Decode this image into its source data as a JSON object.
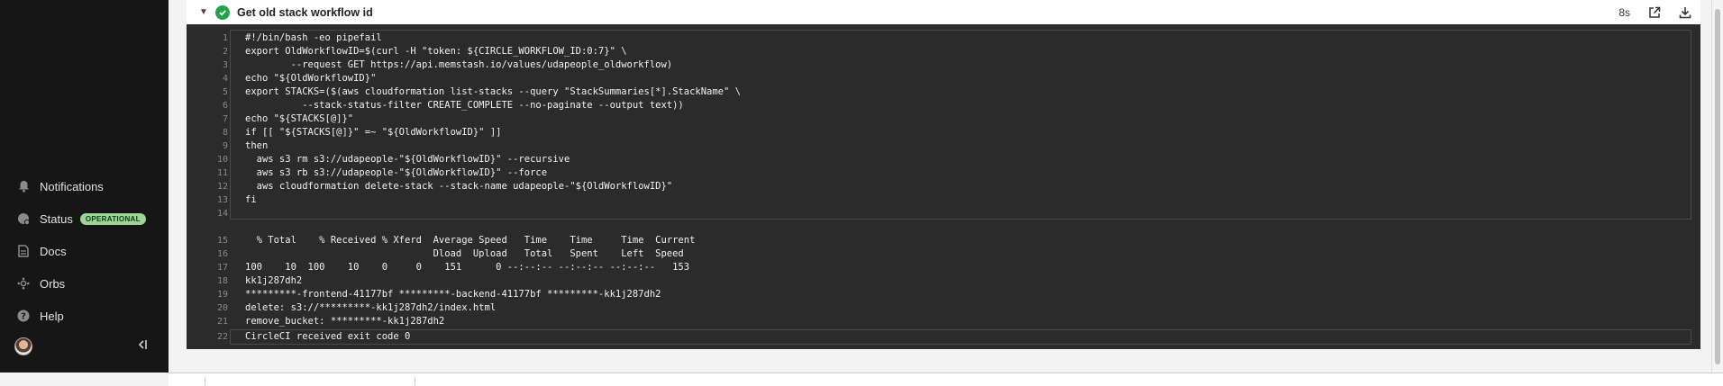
{
  "sidebar": {
    "items": [
      {
        "key": "notifications",
        "label": "Notifications",
        "icon": "bell-icon"
      },
      {
        "key": "status",
        "label": "Status",
        "icon": "status-icon",
        "badge": "OPERATIONAL"
      },
      {
        "key": "docs",
        "label": "Docs",
        "icon": "document-icon"
      },
      {
        "key": "orbs",
        "label": "Orbs",
        "icon": "orbs-icon"
      },
      {
        "key": "help",
        "label": "Help",
        "icon": "help-icon"
      }
    ]
  },
  "step": {
    "title": "Get old stack workflow id",
    "duration": "8s",
    "status": "success"
  },
  "script_lines": [
    {
      "n": "1",
      "text": "#!/bin/bash -eo pipefail"
    },
    {
      "n": "2",
      "text": "export OldWorkflowID=$(curl -H \"token: ${CIRCLE_WORKFLOW_ID:0:7}\" \\"
    },
    {
      "n": "3",
      "text": "        --request GET https://api.memstash.io/values/udapeople_oldworkflow)"
    },
    {
      "n": "4",
      "text": "echo \"${OldWorkflowID}\""
    },
    {
      "n": "5",
      "text": "export STACKS=($(aws cloudformation list-stacks --query \"StackSummaries[*].StackName\" \\"
    },
    {
      "n": "6",
      "text": "          --stack-status-filter CREATE_COMPLETE --no-paginate --output text))"
    },
    {
      "n": "7",
      "text": "echo \"${STACKS[@]}\""
    },
    {
      "n": "8",
      "text": "if [[ \"${STACKS[@]}\" =~ \"${OldWorkflowID}\" ]]"
    },
    {
      "n": "9",
      "text": "then"
    },
    {
      "n": "10",
      "text": "  aws s3 rm s3://udapeople-\"${OldWorkflowID}\" --recursive"
    },
    {
      "n": "11",
      "text": "  aws s3 rb s3://udapeople-\"${OldWorkflowID}\" --force"
    },
    {
      "n": "12",
      "text": "  aws cloudformation delete-stack --stack-name udapeople-\"${OldWorkflowID}\""
    },
    {
      "n": "13",
      "text": "fi"
    },
    {
      "n": "14",
      "text": ""
    }
  ],
  "output_lines": [
    {
      "n": "15",
      "text": "  % Total    % Received % Xferd  Average Speed   Time    Time     Time  Current"
    },
    {
      "n": "16",
      "text": "                                 Dload  Upload   Total   Spent    Left  Speed"
    },
    {
      "n": "17",
      "text": "100    10  100    10    0     0    151      0 --:--:-- --:--:-- --:--:--   153"
    },
    {
      "n": "18",
      "text": "kk1j287dh2"
    },
    {
      "n": "19",
      "text": "*********-frontend-41177bf *********-backend-41177bf *********-kk1j287dh2"
    },
    {
      "n": "20",
      "text": "delete: s3://*********-kk1j287dh2/index.html"
    },
    {
      "n": "21",
      "text": "remove_bucket: *********-kk1j287dh2"
    },
    {
      "n": "22",
      "text": "CircleCI received exit code 0"
    }
  ],
  "colors": {
    "sidebar_bg": "#161616",
    "terminal_bg": "#2b2b2b",
    "success_green": "#23a34a",
    "badge_bg": "#9ed39a"
  }
}
